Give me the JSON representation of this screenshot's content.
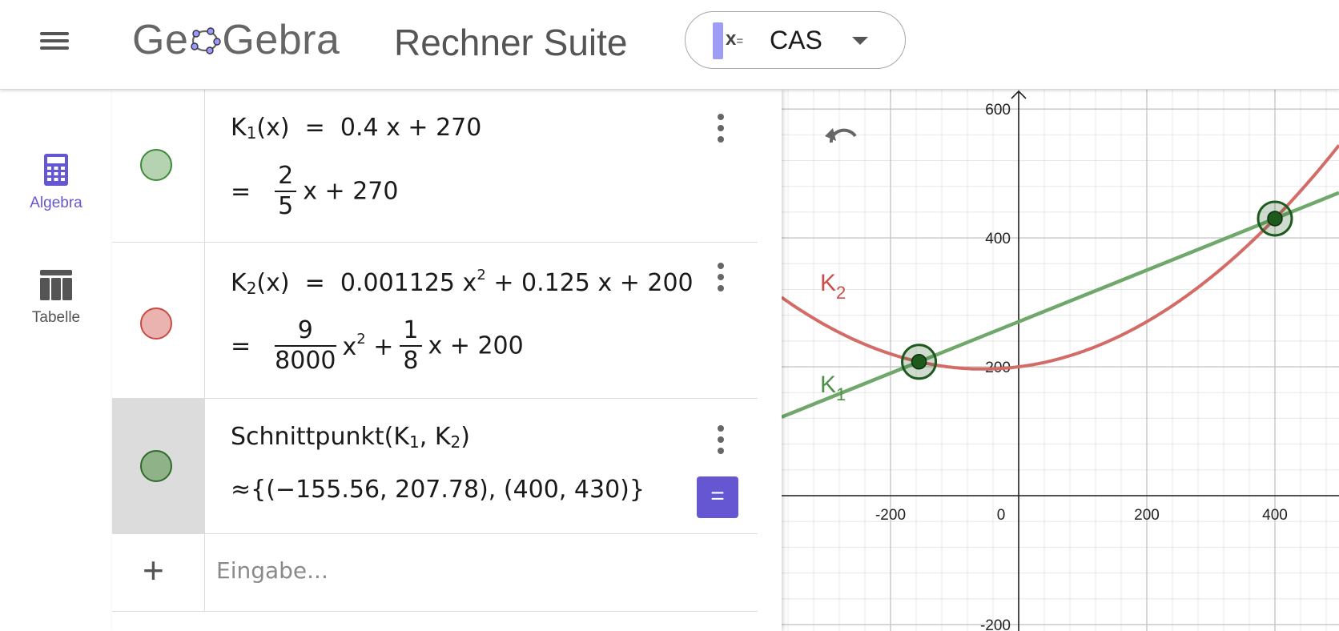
{
  "header": {
    "logo_text_left": "Ge",
    "logo_text_right": "Gebra",
    "title": "Rechner Suite",
    "app_picker": {
      "icon_text": "x",
      "icon_suffix": "=",
      "label": "CAS"
    }
  },
  "sidebar": {
    "items": [
      {
        "label": "Algebra",
        "icon": "calculator-icon",
        "active": true
      },
      {
        "label": "Tabelle",
        "icon": "table-icon",
        "active": false
      }
    ]
  },
  "algebra": {
    "rows": [
      {
        "color": "#b5d3b0",
        "border": "#3f8a3a",
        "name": "K",
        "sub": "1",
        "def_rhs": "0.4 x + 270",
        "out_num": "2",
        "out_den": "5",
        "out_rest": "x + 270"
      },
      {
        "color": "#ebb3b0",
        "border": "#c94a43",
        "name": "K",
        "sub": "2",
        "def_a": "0.001125 x",
        "def_b": "+ 0.125 x + 200",
        "out_num1": "9",
        "out_den1": "8000",
        "out_x2": "x",
        "out_plus": "+",
        "out_num2": "1",
        "out_den2": "8",
        "out_rest": "x + 200"
      },
      {
        "color": "#8fb289",
        "border": "#2f6a2a",
        "cmd": "Schnittpunkt(K",
        "sub1": "1",
        "sep": ", K",
        "sub2": "2",
        "close": ")",
        "approx": "≈",
        "result": "{(−155.56, 207.78), (400, 430)}",
        "eq_button": "="
      }
    ],
    "input_placeholder": "Eingabe..."
  },
  "graphics": {
    "x_ticks": [
      "-200",
      "0",
      "200",
      "400"
    ],
    "y_ticks": [
      "600",
      "400",
      "200",
      "-200"
    ],
    "curve_labels": {
      "k1": "K",
      "k1_sub": "1",
      "k2": "K",
      "k2_sub": "2"
    },
    "colors": {
      "k1": "#6fa86a",
      "k2": "#d36b66",
      "point": "#1e5a1e"
    },
    "chart_data": {
      "type": "line",
      "series": [
        {
          "name": "K1",
          "formula": "0.4 x + 270"
        },
        {
          "name": "K2",
          "formula": "0.001125 x^2 + 0.125 x + 200"
        }
      ],
      "points": [
        {
          "x": -155.56,
          "y": 207.78
        },
        {
          "x": 400,
          "y": 430
        }
      ],
      "xlim": [
        -370,
        500
      ],
      "ylim": [
        -210,
        630
      ],
      "grid": true
    }
  }
}
